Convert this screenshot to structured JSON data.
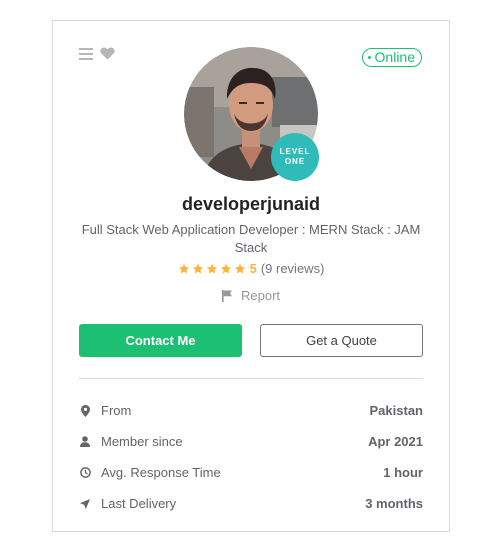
{
  "profile": {
    "status": "Online",
    "level_line1": "LEVEL",
    "level_line2": "ONE",
    "username": "developerjunaid",
    "tagline": "Full Stack Web Application Developer : MERN Stack : JAM Stack",
    "rating": "5",
    "reviews": "(9 reviews)",
    "report_label": "Report"
  },
  "actions": {
    "contact_label": "Contact Me",
    "quote_label": "Get a Quote"
  },
  "stats": [
    {
      "label": "From",
      "value": "Pakistan",
      "icon": "location-pin-icon"
    },
    {
      "label": "Member since",
      "value": "Apr 2021",
      "icon": "user-icon"
    },
    {
      "label": "Avg. Response Time",
      "value": "1 hour",
      "icon": "clock-icon"
    },
    {
      "label": "Last Delivery",
      "value": "3 months",
      "icon": "send-icon"
    }
  ],
  "colors": {
    "accent": "#1dbf73",
    "star": "#ffb33e",
    "level_badge": "#2ebbba",
    "text_muted": "#62646a"
  }
}
